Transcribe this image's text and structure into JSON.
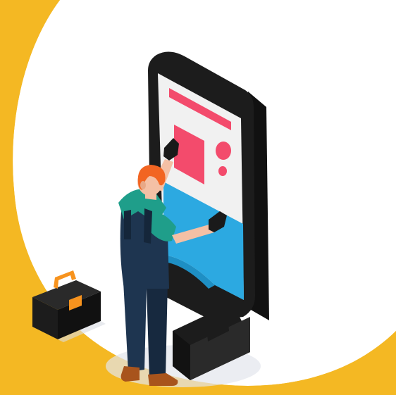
{
  "scene": {
    "description_free": true,
    "colors": {
      "background_yellow": "#F4B823",
      "white_circle": "#FFFFFF",
      "kiosk_frame": "#1C1C1C",
      "kiosk_side": "#2A2A2A",
      "screen": "#F1F1F1",
      "pink": "#F34B6C",
      "blue": "#2CA9E1",
      "skin": "#F4C0A5",
      "hair": "#F26522",
      "shirt": "#1F9E8A",
      "overalls": "#1E3550",
      "glove": "#1A1A1A",
      "shoe": "#A8541C",
      "toolbox": "#1C1C1C",
      "toolbox_handle": "#F7931E"
    },
    "icons": [
      "digital-kiosk-icon",
      "technician-icon",
      "toolbox-icon"
    ]
  }
}
